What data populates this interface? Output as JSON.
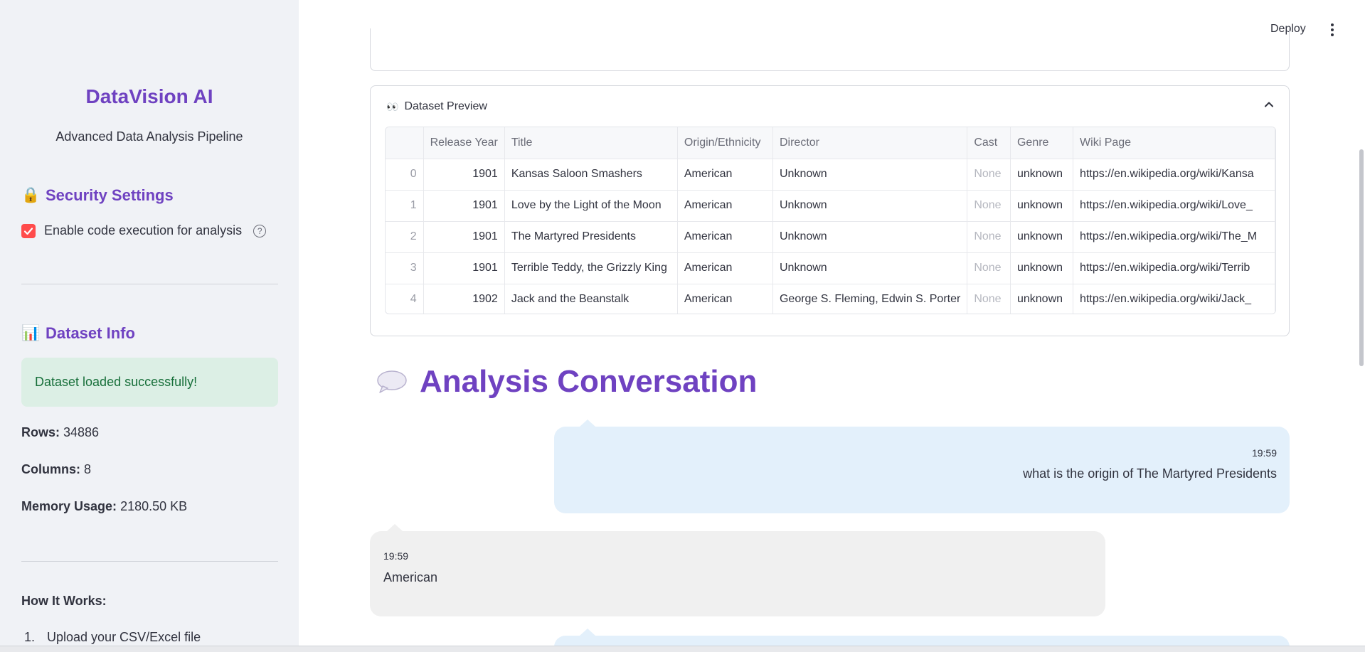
{
  "sidebar": {
    "title": "DataVision AI",
    "subtitle": "Advanced Data Analysis Pipeline",
    "security": {
      "icon": "lock-icon",
      "heading": "Security Settings",
      "checkbox_label": "Enable code execution for analysis",
      "checked": true
    },
    "dataset_info": {
      "icon": "bar-chart-icon",
      "heading": "Dataset Info",
      "success_message": "Dataset loaded successfully!",
      "rows_label": "Rows:",
      "rows_value": "34886",
      "columns_label": "Columns:",
      "columns_value": "8",
      "memory_label": "Memory Usage:",
      "memory_value": "2180.50 KB"
    },
    "how_it_works": {
      "title": "How It Works:",
      "steps": [
        {
          "num": "1.",
          "text": "Upload your CSV/Excel file"
        }
      ]
    }
  },
  "header": {
    "deploy_label": "Deploy"
  },
  "preview": {
    "icon": "eyes-icon",
    "title": "Dataset Preview",
    "columns": [
      "",
      "Release Year",
      "Title",
      "Origin/Ethnicity",
      "Director",
      "Cast",
      "Genre",
      "Wiki Page"
    ],
    "rows": [
      [
        "0",
        "1901",
        "Kansas Saloon Smashers",
        "American",
        "Unknown",
        "None",
        "unknown",
        "https://en.wikipedia.org/wiki/Kansa"
      ],
      [
        "1",
        "1901",
        "Love by the Light of the Moon",
        "American",
        "Unknown",
        "None",
        "unknown",
        "https://en.wikipedia.org/wiki/Love_"
      ],
      [
        "2",
        "1901",
        "The Martyred Presidents",
        "American",
        "Unknown",
        "None",
        "unknown",
        "https://en.wikipedia.org/wiki/The_M"
      ],
      [
        "3",
        "1901",
        "Terrible Teddy, the Grizzly King",
        "American",
        "Unknown",
        "None",
        "unknown",
        "https://en.wikipedia.org/wiki/Terrib"
      ],
      [
        "4",
        "1902",
        "Jack and the Beanstalk",
        "American",
        "George S. Fleming, Edwin S. Porter",
        "None",
        "unknown",
        "https://en.wikipedia.org/wiki/Jack_"
      ]
    ]
  },
  "conversation": {
    "icon": "speech-bubble-icon",
    "title": "Analysis Conversation",
    "messages": [
      {
        "role": "user",
        "time": "19:59",
        "text": "what is the origin of The Martyred Presidents"
      },
      {
        "role": "assistant",
        "time": "19:59",
        "text": "American"
      }
    ]
  },
  "colors": {
    "accent": "#6f42c1",
    "checkbox": "#ff4b4b",
    "success_bg": "#dcefe5",
    "user_bubble": "#e3f0fb",
    "assistant_bubble": "#f0f0f0"
  }
}
